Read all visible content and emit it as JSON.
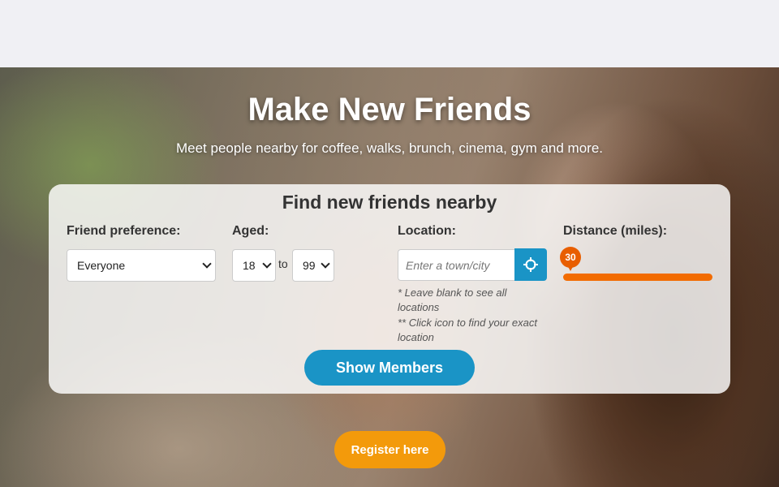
{
  "hero": {
    "title": "Make New Friends",
    "subtitle": "Meet people nearby for coffee, walks, brunch, cinema, gym and more."
  },
  "search": {
    "title": "Find new friends nearby",
    "preference_label": "Friend preference:",
    "preference_value": "Everyone",
    "aged_label": "Aged:",
    "age_min": "18",
    "age_to": "to",
    "age_max": "99",
    "location_label": "Location:",
    "location_placeholder": "Enter a town/city",
    "location_note_1": "* Leave blank to see all locations",
    "location_note_2": "** Click icon to find your exact location",
    "locate_icon": "crosshair-icon",
    "distance_label": "Distance (miles):",
    "distance_value": "30",
    "submit_label": "Show Members"
  },
  "register": {
    "label": "Register here"
  },
  "colors": {
    "primary_blue": "#1a94c6",
    "slider_orange": "#f26b00",
    "register_orange": "#f39a0b"
  }
}
